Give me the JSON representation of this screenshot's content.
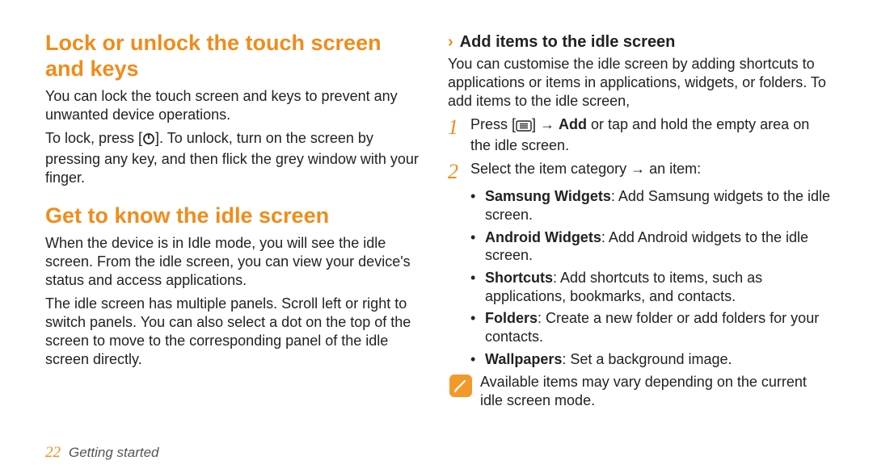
{
  "left": {
    "h1a": "Lock or unlock the touch screen and keys",
    "p1": "You can lock the touch screen and keys to prevent any unwanted device operations.",
    "p2_pre": "To lock, press [",
    "p2_post": "]. To unlock, turn on the screen by pressing any key, and then flick the grey window with your finger.",
    "h1b": "Get to know the idle screen",
    "p3": "When the device is in Idle mode, you will see the idle screen. From the idle screen, you can view your device's status and access applications.",
    "p4": "The idle screen has multiple panels. Scroll left or right to switch panels. You can also select a dot on the top of the screen to move to the corresponding panel of the idle screen directly."
  },
  "right": {
    "sub": "Add items to the idle screen",
    "intro": "You can customise the idle screen by adding shortcuts to applications or items in applications, widgets, or folders. To add items to the idle screen,",
    "step1_pre": "Press [",
    "step1_mid": "] → ",
    "step1_bold": "Add",
    "step1_post": " or tap and hold the empty area on the idle screen.",
    "step2": "Select the item category → an item:",
    "bullets": [
      {
        "b": "Samsung Widgets",
        "t": ": Add Samsung widgets to the idle screen."
      },
      {
        "b": "Android Widgets",
        "t": ": Add Android widgets to the idle screen."
      },
      {
        "b": "Shortcuts",
        "t": ": Add shortcuts to items, such as applications, bookmarks, and contacts."
      },
      {
        "b": "Folders",
        "t": ": Create a new folder or add folders for your contacts."
      },
      {
        "b": "Wallpapers",
        "t": ": Set a background image."
      }
    ],
    "note": "Available items may vary depending on the current idle screen mode."
  },
  "footer": {
    "page": "22",
    "section": "Getting started"
  },
  "nums": {
    "one": "1",
    "two": "2"
  }
}
